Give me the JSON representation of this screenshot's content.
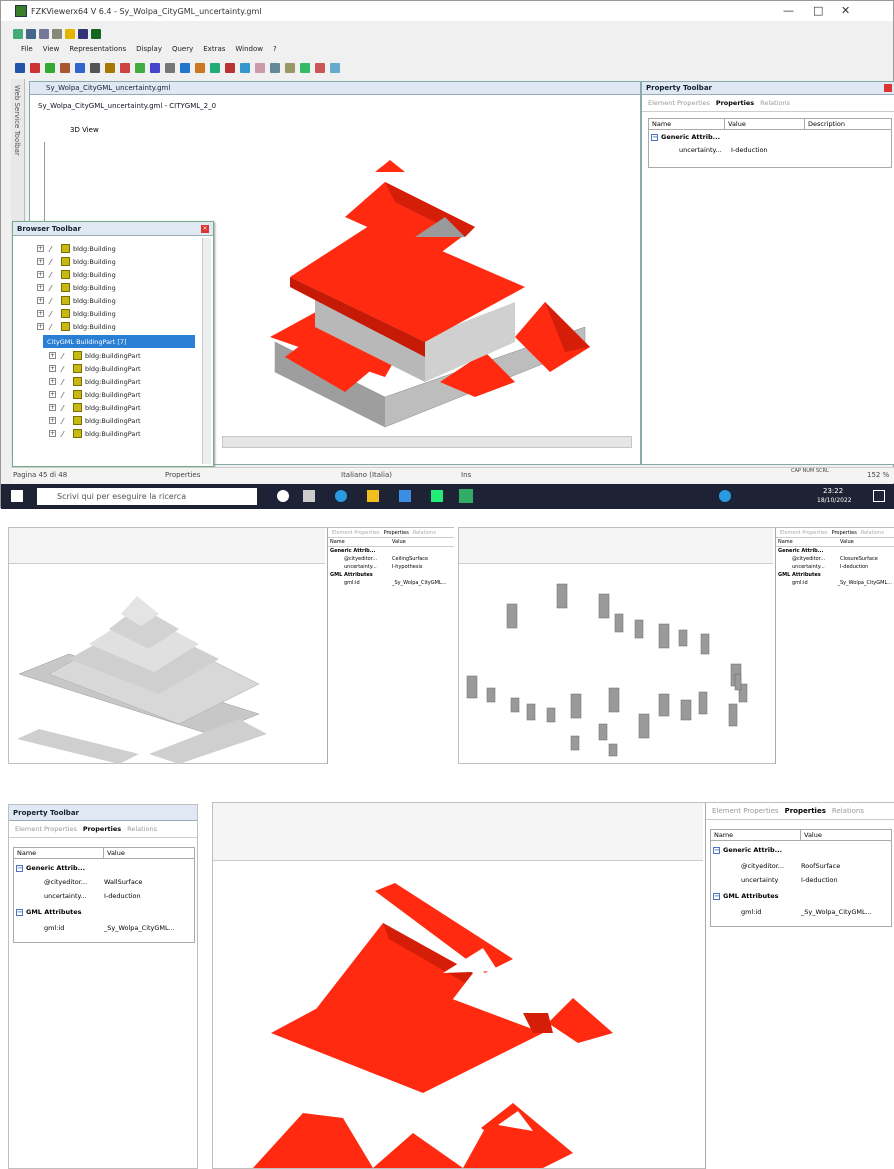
{
  "window": {
    "title": "FZKViewerx64 V 6.4 - Sy_Wolpa_CityGML_uncertainty.gml",
    "menu": [
      "File",
      "View",
      "Representations",
      "Display",
      "Query",
      "Extras",
      "Window",
      "?"
    ],
    "controls": {
      "minimize": "—",
      "maximize": "□",
      "close": "✕"
    }
  },
  "sidebar_label": "Web Service Toolbar",
  "document": {
    "tab_title": "Sy_Wolpa_CityGML_uncertainty.gml",
    "subtitle": "Sy_Wolpa_CityGML_uncertainty.gml - CITYGML_2_0",
    "view_tab": "3D View"
  },
  "browser": {
    "title": "Browser Toolbar",
    "buildings": [
      "bldg:Building",
      "bldg:Building",
      "bldg:Building",
      "bldg:Building",
      "bldg:Building",
      "bldg:Building",
      "bldg:Building"
    ],
    "selected": "CityGML BuildingPart [7]",
    "parts": [
      "bldg:BuildingPart",
      "bldg:BuildingPart",
      "bldg:BuildingPart",
      "bldg:BuildingPart",
      "bldg:BuildingPart",
      "bldg:BuildingPart",
      "bldg:BuildingPart"
    ]
  },
  "property": {
    "title": "Property Toolbar",
    "tabs": [
      "Element Properties",
      "Properties",
      "Relations"
    ],
    "columns": [
      "Name",
      "Value",
      "Description"
    ],
    "group": "Generic Attrib...",
    "rows": [
      {
        "name": "uncertainty...",
        "value": "I-deduction"
      }
    ]
  },
  "status": {
    "page": "Pagina 45 di 48",
    "properties": "Properties",
    "language": "Italiano (Italia)",
    "mode": "Ins",
    "zoom": "152 %",
    "caps": "CAP NUM SCRL"
  },
  "taskbar": {
    "search_placeholder": "Scrivi qui per eseguire la ricerca",
    "time": "23:22",
    "date": "18/10/2022"
  },
  "panel1": {
    "tabs": [
      "Element Properties",
      "Properties",
      "Relations"
    ],
    "columns": [
      "Name",
      "Value"
    ],
    "group": "Generic Attrib...",
    "rows": [
      {
        "name": "@cityeditor...",
        "value": "CeilingSurface"
      },
      {
        "name": "uncertainty...",
        "value": "I-hypothesis"
      }
    ],
    "group2": "GML Attributes",
    "rows2": [
      {
        "name": "gml:id",
        "value": "_Sy_Wolpa_CityGML..."
      }
    ]
  },
  "panel2": {
    "tabs": [
      "Element Properties",
      "Properties",
      "Relations"
    ],
    "columns": [
      "Name",
      "Value"
    ],
    "group": "Generic Attrib...",
    "rows": [
      {
        "name": "@cityeditor...",
        "value": "ClosureSurface"
      },
      {
        "name": "uncertainty...",
        "value": "I-deduction"
      }
    ],
    "group2": "GML Attributes",
    "rows2": [
      {
        "name": "gml:id",
        "value": "_Sy_Wolpa_CityGML..."
      }
    ]
  },
  "panel3": {
    "title": "Property Toolbar",
    "tabs": [
      "Element Properties",
      "Properties",
      "Relations"
    ],
    "columns": [
      "Name",
      "Value"
    ],
    "group": "Generic Attrib...",
    "rows": [
      {
        "name": "@cityeditor...",
        "value": "WallSurface"
      },
      {
        "name": "uncertainty...",
        "value": "I-deduction"
      }
    ],
    "group2": "GML Attributes",
    "rows2": [
      {
        "name": "gml:id",
        "value": "_Sy_Wolpa_CityGML..."
      }
    ]
  },
  "panel4": {
    "tabs": [
      "Element Properties",
      "Properties",
      "Relations"
    ],
    "columns": [
      "Name",
      "Value"
    ],
    "group": "Generic Attrib...",
    "rows": [
      {
        "name": "@cityeditor...",
        "value": "RoofSurface"
      },
      {
        "name": "uncertainty",
        "value": "I-deduction"
      }
    ],
    "group2": "GML Attributes",
    "rows2": [
      {
        "name": "gml:id",
        "value": "_Sy_Wolpa_CityGML..."
      }
    ]
  },
  "colors": {
    "roof": "#ff2a10",
    "wall": "#c4c4c4",
    "accent": "#2a7fd4",
    "taskbar": "#1d2334"
  }
}
